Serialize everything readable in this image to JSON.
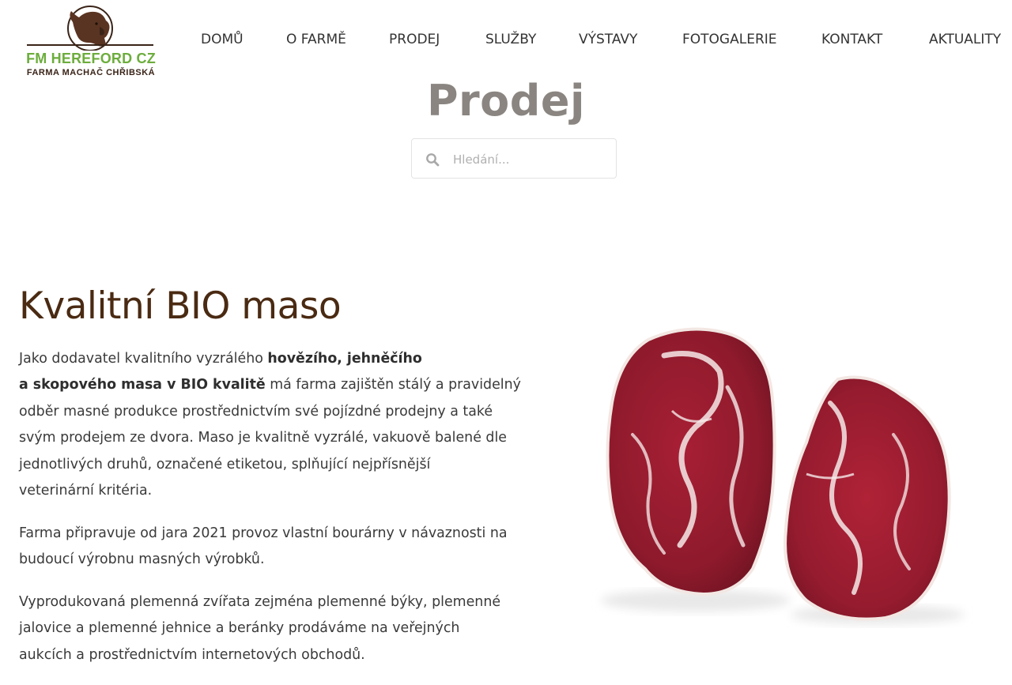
{
  "logo": {
    "brand": "FM HEREFORD CZ",
    "subtitle": "FARMA MACHAČ CHŘIBSKÁ",
    "icon": "cow-head-icon"
  },
  "nav": {
    "items": [
      "DOMŮ",
      "O FARMĚ",
      "PRODEJ",
      "SLUŽBY",
      "VÝSTAVY",
      "FOTOGALERIE",
      "KONTAKT",
      "AKTUALITY"
    ]
  },
  "page": {
    "title": "Prodej"
  },
  "search": {
    "placeholder": "Hledání...",
    "value": "",
    "icon": "search-icon"
  },
  "content": {
    "heading": "Kvalitní BIO maso",
    "p1": {
      "line1_pre": "Jako dodavatel kvalitního vyzrálého ",
      "line1_bold": "hovězího, jehněčího",
      "line2_bold": "a skopového masa v BIO kvalitě",
      "line2_post": " má farma zajištěn stálý a pravidelný",
      "line3": "odběr masné produkce prostřednictvím své pojízdné prodejny a také",
      "line4": "svým prodejem ze dvora. Maso je kvalitně vyzrálé, vakuově balené dle",
      "line5": "jednotlivých druhů, označené etiketou, splňující nejpřísnější",
      "line6": "veterinární kritéria."
    },
    "p2": {
      "line1": "Farma připravuje od jara 2021 provoz vlastní bourárny v návaznosti na",
      "line2": "budoucí výrobnu masných výrobků."
    },
    "p3": {
      "line1": "Vyprodukovaná plemenná zvířata zejména plemenné býky, plemenné",
      "line2": "jalovice a plemenné jehnice a beránky prodáváme na veřejných",
      "line3": "aukcích a prostřednictvím internetových obchodů."
    }
  },
  "image": {
    "icon": "raw-beef-steaks-image"
  },
  "colors": {
    "brand_green": "#6cad3c",
    "brand_brown": "#3a2418",
    "heading_brown": "#4a2a12",
    "title_gray": "#8a8580",
    "meat_red": "#9e1f2e"
  }
}
